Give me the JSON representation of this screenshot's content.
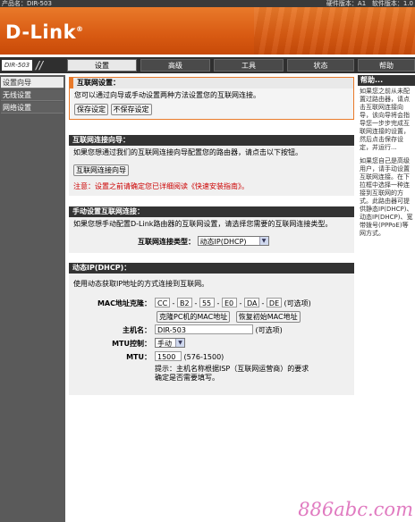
{
  "topbar": {
    "product_label": "产品名：DIR-503",
    "hw_version": "硬件版本：A1",
    "fw_version": "软件版本：1.0"
  },
  "brand": {
    "logo": "D-Link"
  },
  "model_badge": "DIR-503",
  "tabs": [
    "设置",
    "高级",
    "工具",
    "状态",
    "帮助"
  ],
  "sidebar": {
    "items": [
      "设置向导",
      "无线设置",
      "网络设置"
    ]
  },
  "internet_setup": {
    "title": "互联网设置：",
    "desc": "您可以通过向导或手动设置两种方法设置您的互联网连接。",
    "save_button": "保存设定",
    "nosave_button": "不保存设定"
  },
  "wizard": {
    "title": "互联网连接向导：",
    "desc": "如果您想通过我们的互联网连接向导配置您的路由器，请点击以下按钮。",
    "button": "互联网连接向导",
    "note": "注意：设置之前请确定您已详细阅读《快速安装指南》。"
  },
  "manual": {
    "title": "手动设置互联网连接：",
    "desc": "如果您想手动配置D-Link路由器的互联网设置，请选择您需要的互联网连接类型。",
    "type_label": "互联网连接类型：",
    "type_value": "动态IP(DHCP)"
  },
  "dhcp": {
    "title": "动态IP(DHCP)：",
    "desc": "使用动态获取IP地址的方式连接到互联网。",
    "mac_label": "MAC地址克隆：",
    "mac": [
      "CC",
      "B2",
      "55",
      "E0",
      "DA",
      "DE"
    ],
    "mac_optional": "(可选项)",
    "clone_button": "克隆PC机的MAC地址",
    "restore_button": "恢复初始MAC地址",
    "host_label": "主机名：",
    "host_value": "DIR-503",
    "host_optional": "(可选项)",
    "mtu_ctrl_label": "MTU控制：",
    "mtu_ctrl_value": "手动",
    "mtu_label": "MTU：",
    "mtu_value": "1500",
    "mtu_range": "(576-1500)",
    "hint_line1": "提示：主机名称根据ISP（互联网运营商）的要求",
    "hint_line2": "确定是否需要填写。"
  },
  "help": {
    "title": "帮助...",
    "p1": "如果您之前从未配置过路由器，请点击互联网连接向导，该向导将会指导您一步步完成互联网连接的设置，然后点击保存设定，并运行...",
    "p2": "如果您自己是高级用户，请手动设置互联网连接。在下拉框中选择一种连接到互联网的方式。此路由器可提供静态IP(DHCP)、动态IP(DHCP)、宽带拨号(PPPoE)等网方式。"
  },
  "watermark": "886abc.com"
}
